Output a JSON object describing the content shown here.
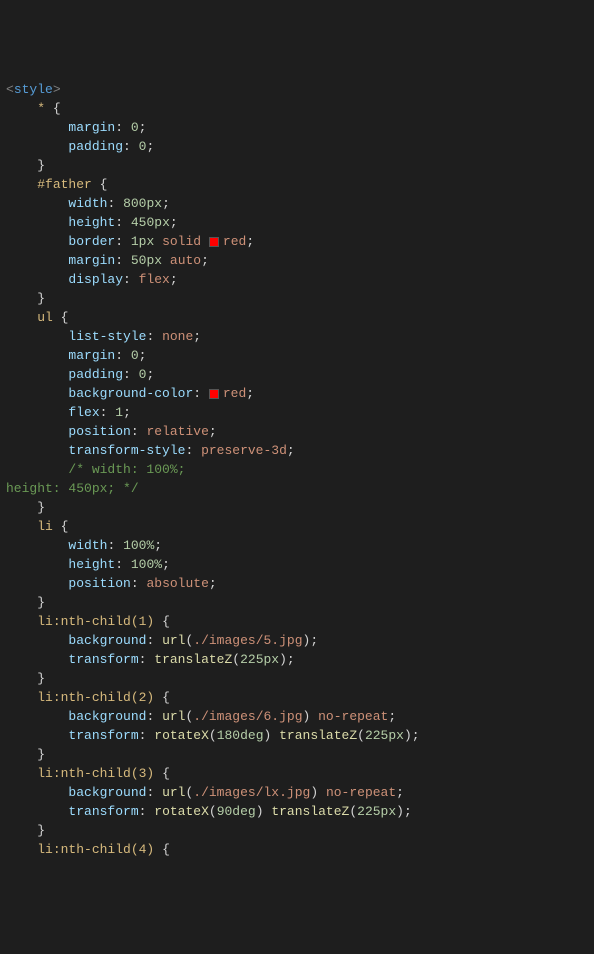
{
  "code": {
    "openTag": {
      "lt": "<",
      "name": "style",
      "gt": ">"
    },
    "rules": [
      {
        "selector": "*",
        "decls": [
          {
            "prop": "margin",
            "value": [
              {
                "t": "num",
                "v": "0"
              }
            ]
          },
          {
            "prop": "padding",
            "value": [
              {
                "t": "num",
                "v": "0"
              }
            ]
          }
        ]
      },
      {
        "selector": "#father",
        "decls": [
          {
            "prop": "width",
            "value": [
              {
                "t": "num",
                "v": "800px"
              }
            ]
          },
          {
            "prop": "height",
            "value": [
              {
                "t": "num",
                "v": "450px"
              }
            ]
          },
          {
            "prop": "border",
            "value": [
              {
                "t": "num",
                "v": "1px"
              },
              {
                "t": "sp"
              },
              {
                "t": "val",
                "v": "solid"
              },
              {
                "t": "sp"
              },
              {
                "t": "swatch"
              },
              {
                "t": "val",
                "v": "red"
              }
            ]
          },
          {
            "prop": "margin",
            "value": [
              {
                "t": "num",
                "v": "50px"
              },
              {
                "t": "sp"
              },
              {
                "t": "val",
                "v": "auto"
              }
            ]
          },
          {
            "prop": "display",
            "value": [
              {
                "t": "val",
                "v": "flex"
              }
            ]
          }
        ]
      },
      {
        "selector": "ul",
        "decls": [
          {
            "prop": "list-style",
            "value": [
              {
                "t": "val",
                "v": "none"
              }
            ]
          },
          {
            "prop": "margin",
            "value": [
              {
                "t": "num",
                "v": "0"
              }
            ]
          },
          {
            "prop": "padding",
            "value": [
              {
                "t": "num",
                "v": "0"
              }
            ]
          },
          {
            "prop": "background-color",
            "value": [
              {
                "t": "swatch"
              },
              {
                "t": "val",
                "v": "red"
              }
            ]
          },
          {
            "prop": "flex",
            "value": [
              {
                "t": "num",
                "v": "1"
              }
            ]
          },
          {
            "prop": "position",
            "value": [
              {
                "t": "val",
                "v": "relative"
              }
            ]
          },
          {
            "prop": "transform-style",
            "value": [
              {
                "t": "val",
                "v": "preserve-3d"
              }
            ]
          }
        ],
        "trailingComment": [
          "/* width: 100%;",
          "height: 450px; */"
        ]
      },
      {
        "selector": "li",
        "decls": [
          {
            "prop": "width",
            "value": [
              {
                "t": "num",
                "v": "100%"
              }
            ]
          },
          {
            "prop": "height",
            "value": [
              {
                "t": "num",
                "v": "100%"
              }
            ]
          },
          {
            "prop": "position",
            "value": [
              {
                "t": "val",
                "v": "absolute"
              }
            ]
          }
        ]
      },
      {
        "selector": "li:nth-child(1)",
        "decls": [
          {
            "prop": "background",
            "value": [
              {
                "t": "func",
                "v": "url"
              },
              {
                "t": "paren",
                "v": "("
              },
              {
                "t": "val",
                "v": "./images/5.jpg"
              },
              {
                "t": "paren",
                "v": ")"
              }
            ]
          },
          {
            "prop": "transform",
            "value": [
              {
                "t": "func",
                "v": "translateZ"
              },
              {
                "t": "paren",
                "v": "("
              },
              {
                "t": "num",
                "v": "225px"
              },
              {
                "t": "paren",
                "v": ")"
              }
            ]
          }
        ]
      },
      {
        "selector": "li:nth-child(2)",
        "decls": [
          {
            "prop": "background",
            "value": [
              {
                "t": "func",
                "v": "url"
              },
              {
                "t": "paren",
                "v": "("
              },
              {
                "t": "val",
                "v": "./images/6.jpg"
              },
              {
                "t": "paren",
                "v": ")"
              },
              {
                "t": "sp"
              },
              {
                "t": "val",
                "v": "no-repeat"
              }
            ]
          },
          {
            "prop": "transform",
            "value": [
              {
                "t": "func",
                "v": "rotateX"
              },
              {
                "t": "paren",
                "v": "("
              },
              {
                "t": "num",
                "v": "180deg"
              },
              {
                "t": "paren",
                "v": ")"
              },
              {
                "t": "sp"
              },
              {
                "t": "func",
                "v": "translateZ"
              },
              {
                "t": "paren",
                "v": "("
              },
              {
                "t": "num",
                "v": "225px"
              },
              {
                "t": "paren",
                "v": ")"
              }
            ]
          }
        ]
      },
      {
        "selector": "li:nth-child(3)",
        "decls": [
          {
            "prop": "background",
            "value": [
              {
                "t": "func",
                "v": "url"
              },
              {
                "t": "paren",
                "v": "("
              },
              {
                "t": "val",
                "v": "./images/lx.jpg"
              },
              {
                "t": "paren",
                "v": ")"
              },
              {
                "t": "sp"
              },
              {
                "t": "val",
                "v": "no-repeat"
              }
            ]
          },
          {
            "prop": "transform",
            "value": [
              {
                "t": "func",
                "v": "rotateX"
              },
              {
                "t": "paren",
                "v": "("
              },
              {
                "t": "num",
                "v": "90deg"
              },
              {
                "t": "paren",
                "v": ")"
              },
              {
                "t": "sp"
              },
              {
                "t": "func",
                "v": "translateZ"
              },
              {
                "t": "paren",
                "v": "("
              },
              {
                "t": "num",
                "v": "225px"
              },
              {
                "t": "paren",
                "v": ")"
              }
            ]
          }
        ]
      },
      {
        "selector": "li:nth-child(4)",
        "partial": true
      }
    ]
  }
}
